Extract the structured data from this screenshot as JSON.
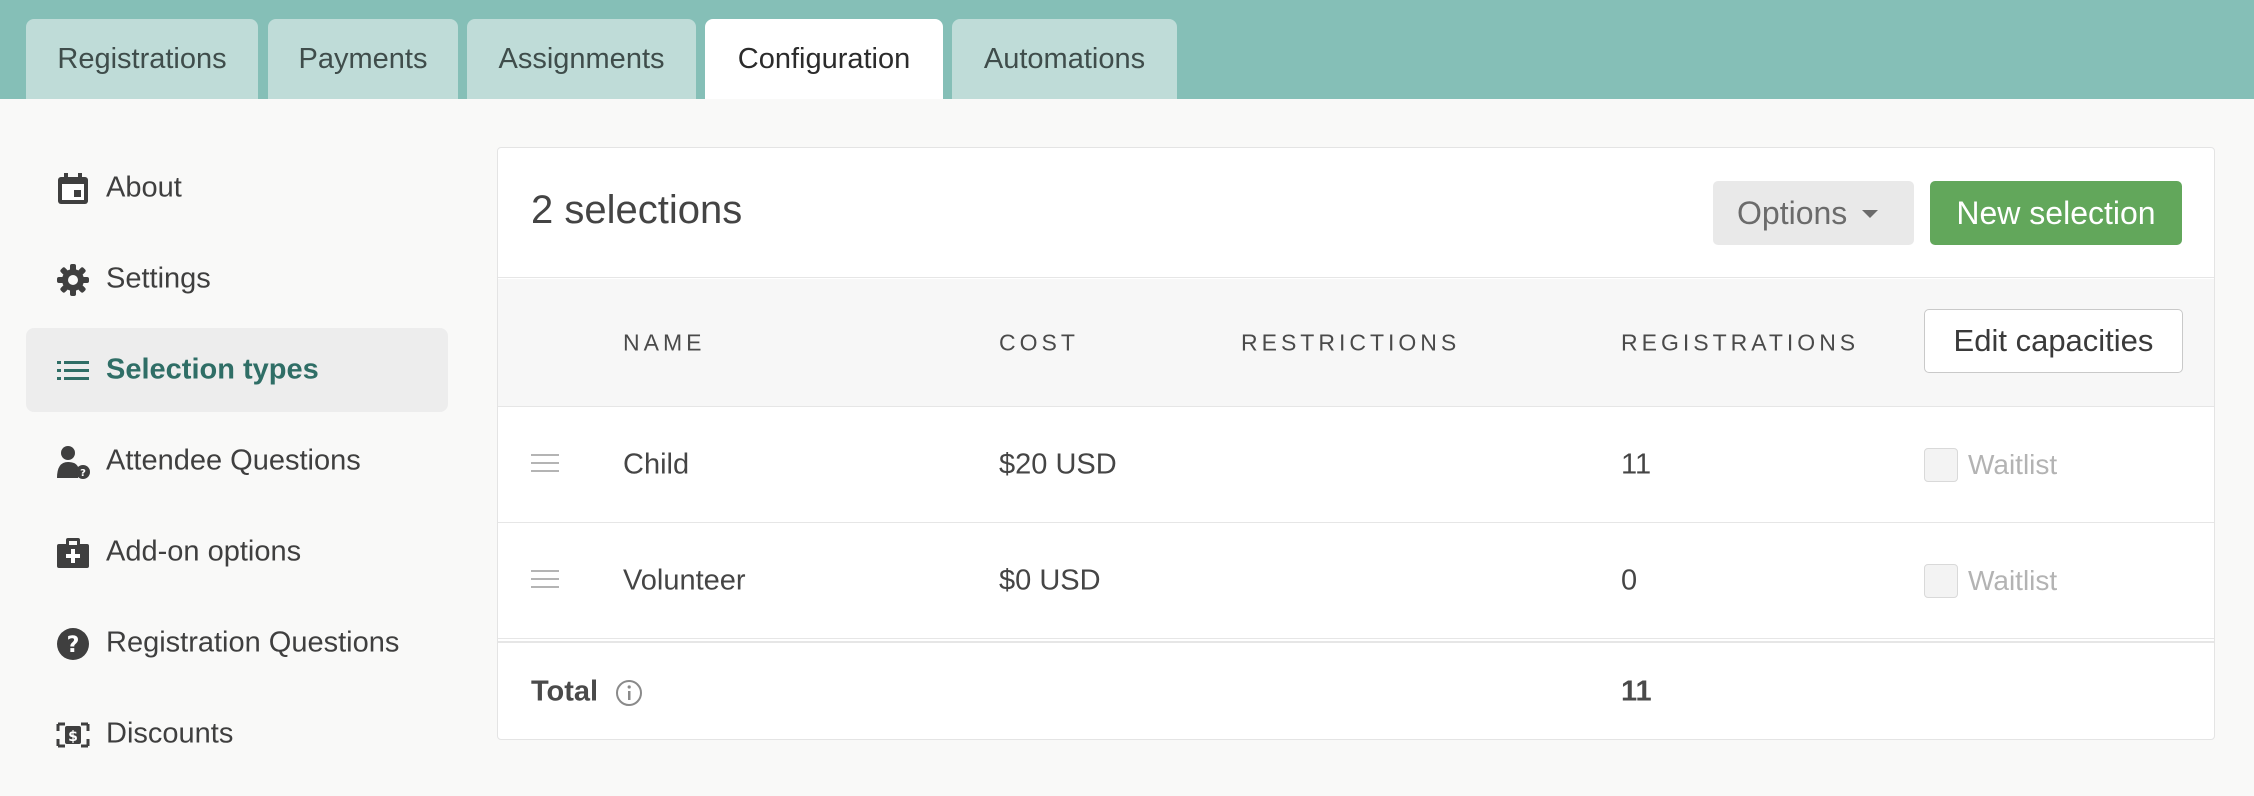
{
  "tabs": [
    {
      "label": "Registrations",
      "active": false
    },
    {
      "label": "Payments",
      "active": false
    },
    {
      "label": "Assignments",
      "active": false
    },
    {
      "label": "Configuration",
      "active": true
    },
    {
      "label": "Automations",
      "active": false
    }
  ],
  "sidebar": {
    "items": [
      {
        "label": "About",
        "icon": "calendar-icon"
      },
      {
        "label": "Settings",
        "icon": "gear-icon"
      },
      {
        "label": "Selection types",
        "icon": "list-icon",
        "active": true
      },
      {
        "label": "Attendee Questions",
        "icon": "person-question-icon"
      },
      {
        "label": "Add-on options",
        "icon": "medical-bag-icon"
      },
      {
        "label": "Registration Questions",
        "icon": "question-circle-icon"
      },
      {
        "label": "Discounts",
        "icon": "discount-icon"
      }
    ]
  },
  "panel": {
    "count_title": "2 selections",
    "options_label": "Options",
    "new_label": "New selection",
    "columns": {
      "name": "NAME",
      "cost": "COST",
      "restrictions": "RESTRICTIONS",
      "registrations": "REGISTRATIONS"
    },
    "edit_capacities_label": "Edit capacities",
    "rows": [
      {
        "name": "Child",
        "cost": "$20 USD",
        "restrictions": "",
        "registrations": "11",
        "waitlist_label": "Waitlist"
      },
      {
        "name": "Volunteer",
        "cost": "$0 USD",
        "restrictions": "",
        "registrations": "0",
        "waitlist_label": "Waitlist"
      }
    ],
    "total_label": "Total",
    "total_value": "11"
  },
  "colors": {
    "tabbar": "#85bfb7",
    "tab_inactive": "#bfdcd8",
    "accent_green": "#62a75b",
    "active_text": "#2f6e66"
  }
}
